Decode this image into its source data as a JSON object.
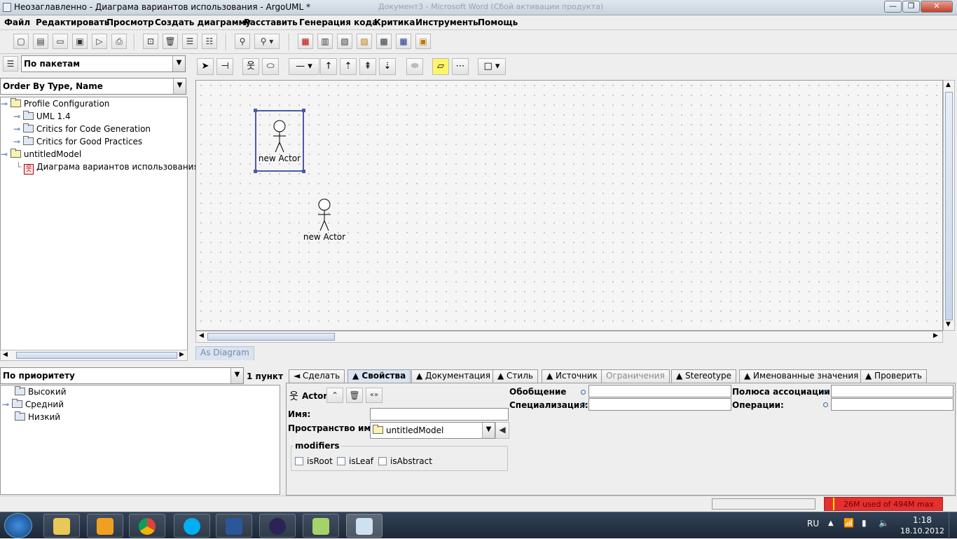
{
  "window": {
    "title": "Неозаглавленно - Диаграма вариантов использования - ArgoUML *",
    "background_title": "Документ3 - Microsoft Word (Сбой активации продукта)",
    "controls": {
      "minimize": "—",
      "maximize": "❐",
      "close": "✕"
    }
  },
  "menu": [
    "Файл",
    "Редактировать",
    "Просмотр",
    "Создать диаграмму",
    "Расставить",
    "Генерация кода",
    "Критика",
    "Инструменты",
    "Помощь"
  ],
  "toolbar": {
    "icons": [
      "new-file-icon",
      "new-project-icon",
      "open-icon",
      "save-icon",
      "save-as-icon",
      "print-icon",
      "navigate-icon",
      "delete-icon",
      "align-icon",
      "distribute-icon",
      "find-icon",
      "zoom-icon",
      "class-diagram-icon",
      "usecase-diagram-icon",
      "state-diagram-icon",
      "activity-diagram-icon",
      "collaboration-diagram-icon",
      "deployment-diagram-icon",
      "sequence-diagram-icon"
    ]
  },
  "explorer": {
    "perspective": "По пакетам",
    "order": "Order By Type, Name",
    "tree": [
      {
        "label": "Profile Configuration",
        "level": 0,
        "type": "folder"
      },
      {
        "label": "UML 1.4",
        "level": 1,
        "type": "folder-blue"
      },
      {
        "label": "Critics for Code Generation",
        "level": 1,
        "type": "folder-blue"
      },
      {
        "label": "Critics for Good Practices",
        "level": 1,
        "type": "folder-blue"
      },
      {
        "label": "untitledModel",
        "level": 0,
        "type": "model"
      },
      {
        "label": "Диаграма вариантов использования",
        "level": 1,
        "type": "diagram"
      }
    ]
  },
  "diagram": {
    "actors": [
      {
        "label": "new Actor",
        "selected": true
      },
      {
        "label": "new Actor",
        "selected": false
      }
    ],
    "tab": "As Diagram"
  },
  "todo": {
    "grouping": "По приоритету",
    "count": "1 пункт",
    "items": [
      "Высокий",
      "Средний",
      "Низкий"
    ]
  },
  "details": {
    "tabs": [
      {
        "label": "◄ Сделать",
        "state": "normal"
      },
      {
        "label": "▲ Свойства",
        "state": "active"
      },
      {
        "label": "▲ Документация",
        "state": "normal"
      },
      {
        "label": "▲ Стиль",
        "state": "normal"
      },
      {
        "label": "▲ Источник",
        "state": "normal"
      },
      {
        "label": "Ограничения",
        "state": "disabled"
      },
      {
        "label": "▲ Stereotype",
        "state": "normal"
      },
      {
        "label": "▲ Именованные значения",
        "state": "normal"
      },
      {
        "label": "▲ Проверить",
        "state": "normal"
      }
    ],
    "element_type": "Actor",
    "name_label": "Имя:",
    "name_value": "",
    "namespace_label": "Пространство имен:",
    "namespace_value": "untitledModel",
    "modifiers_label": "modifiers",
    "modifiers": [
      "isRoot",
      "isLeaf",
      "isAbstract"
    ],
    "generalization_label": "Обобщение",
    "specialization_label": "Специализация:",
    "association_ends_label": "Полюса ассоциации:",
    "operations_label": "Операции:"
  },
  "status": {
    "memory": "26M used of 494M max",
    "memory_fraction": 0.053
  },
  "taskbar": {
    "lang": "RU",
    "time": "1:18",
    "date": "18.10.2012"
  }
}
